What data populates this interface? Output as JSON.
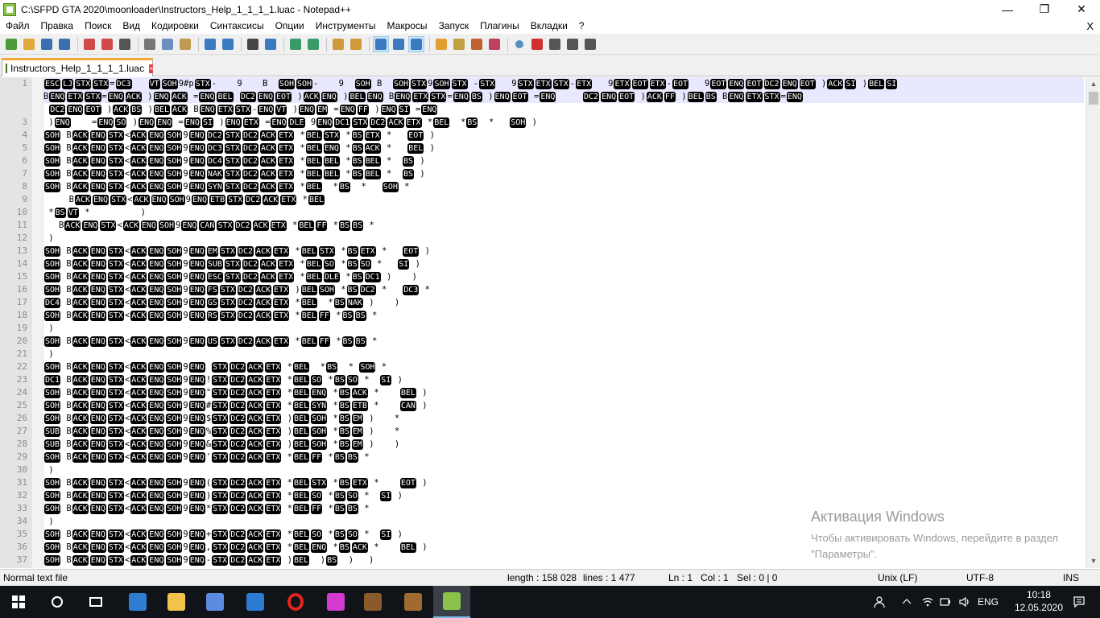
{
  "window": {
    "title": "C:\\SFPD GTA 2020\\moonloader\\Instructors_Help_1_1_1_1.luac - Notepad++",
    "minimize": "—",
    "restore": "❐",
    "close": "✕"
  },
  "menu": {
    "items": [
      "Файл",
      "Правка",
      "Поиск",
      "Вид",
      "Кодировки",
      "Синтаксисы",
      "Опции",
      "Инструменты",
      "Макросы",
      "Запуск",
      "Плагины",
      "Вкладки",
      "?"
    ],
    "close": "X"
  },
  "toolbar": {
    "icons": [
      "new-file-icon",
      "open-file-icon",
      "save-icon",
      "save-all-icon",
      "close-icon",
      "close-all-icon",
      "print-icon",
      "cut-icon",
      "copy-icon",
      "paste-icon",
      "undo-icon",
      "redo-icon",
      "find-icon",
      "replace-icon",
      "zoom-in-icon",
      "zoom-out-icon",
      "sync-v-icon",
      "sync-h-icon",
      "word-wrap-icon",
      "show-all-chars-icon",
      "indent-guide-icon",
      "doc-map-icon",
      "function-list-icon",
      "folder-workspace-icon",
      "monitor-icon",
      "record-macro-icon",
      "stop-record-icon",
      "play-macro-icon",
      "play-multiple-icon",
      "save-macro-icon"
    ],
    "icon_colors": [
      "#4c9a3a",
      "#e0a93a",
      "#3a6fb0",
      "#3a6fb0",
      "#d04a4a",
      "#d04a4a",
      "#555555",
      "#777777",
      "#6a8fc0",
      "#c09a50",
      "#3a7ac0",
      "#3a7ac0",
      "#444444",
      "#3a7ac0",
      "#3a9a6a",
      "#3a9a6a",
      "#d09a3a",
      "#d09a3a",
      "#3a7ac0",
      "#3a7ac0",
      "#3a7ac0",
      "#e0a030",
      "#c0a040",
      "#c06030",
      "#c04060",
      "#5090c0",
      "#d03030",
      "#555555",
      "#555555",
      "#555555"
    ]
  },
  "tab": {
    "label": "Instructors_Help_1_1_1_1.luac",
    "close": "×"
  },
  "editor": {
    "lines": [
      {
        "n": "1",
        "t": "⟦ESC⟧⟦LJ⟧⟦STX⟧⟦STX⟧=⟦DC3⟧   ⟦VT⟧⟦SOH⟧9#p⟦STX⟧-    9    B  ⟦SOH⟧⟦SOH⟧-    9  ⟦SOH⟧ B  ⟦SOH⟧⟦STX⟧9⟦SOH⟧⟦STX⟧ -⟦STX⟧   9⟦STX⟧⟦ETX⟧⟦STX⟧-⟦ETX⟧   9⟦ETX⟧⟦EOT⟧⟦ETX⟧-⟦EOT⟧   9⟦EOT⟧⟦ENQ⟧⟦EOT⟧⟦DC2⟧⟦ENQ⟧⟦EOT⟧ )⟦ACK⟧⟦SI⟧ )⟦BEL⟧⟦SI⟧"
      },
      {
        "n": "",
        "t": "B⟦ENQ⟧⟦ETX⟧⟦STX⟧=⟦ENQ⟧⟦ACK⟧ )⟦ENQ⟧⟦ACK⟧ =⟦ENQ⟧⟦BEL⟧ ⟦DC2⟧⟦ENQ⟧⟦EOT⟧ )⟦ACK⟧⟦ENQ⟧ )⟦BEL⟧⟦ENQ⟧ B⟦ENQ⟧⟦ETX⟧⟦STX⟧=⟦ENQ⟧⟦BS⟧ )⟦ENQ⟧⟦EOT⟧ =⟦ENQ⟧     ⟦DC2⟧⟦ENQ⟧⟦EOT⟧ )⟦ACK⟧⟦FF⟧ )⟦BEL⟧⟦BS⟧ B⟦ENQ⟧⟦ETX⟧⟦STX⟧=⟦ENQ⟧"
      },
      {
        "n": "",
        "t": " ⟦DC2⟧⟦ENQ⟧⟦EOT⟧ )⟦ACK⟧⟦BS⟧ )⟦BEL⟧⟦ACK⟧ B⟦ENQ⟧⟦ETX⟧⟦STX⟧-⟦ENQ⟧⟦VT⟧ )⟦ENQ⟧⟦EM⟧ =⟦ENQ⟧⟦FF⟧ )⟦ENQ⟧⟦SI⟧ =⟦ENQ⟧"
      },
      {
        "n": "3",
        "t": " )⟦ENQ⟧    =⟦ENQ⟧⟦SO⟧ )⟦ENQ⟧⟦ENQ⟧ =⟦ENQ⟧⟦SI⟧ )⟦ENQ⟧⟦ETX⟧ =⟦ENQ⟧⟦DLE⟧ 9⟦ENQ⟧⟦DC1⟧⟦STX⟧⟦DC2⟧⟦ACK⟧⟦ETX⟧ *⟦BEL⟧  *⟦BS⟧  *   ⟦SOH⟧ )"
      },
      {
        "n": "4",
        "t": "⟦SOH⟧ B⟦ACK⟧⟦ENQ⟧⟦STX⟧<⟦ACK⟧⟦ENQ⟧⟦SOH⟧9⟦ENQ⟧⟦DC2⟧⟦STX⟧⟦DC2⟧⟦ACK⟧⟦ETX⟧ *⟦BEL⟧⟦STX⟧ *⟦BS⟧⟦ETX⟧ *   ⟦EOT⟧ )"
      },
      {
        "n": "5",
        "t": "⟦SOH⟧ B⟦ACK⟧⟦ENQ⟧⟦STX⟧<⟦ACK⟧⟦ENQ⟧⟦SOH⟧9⟦ENQ⟧⟦DC3⟧⟦STX⟧⟦DC2⟧⟦ACK⟧⟦ETX⟧ *⟦BEL⟧⟦ENQ⟧ *⟦BS⟧⟦ACK⟧ *   ⟦BEL⟧ )"
      },
      {
        "n": "6",
        "t": "⟦SOH⟧ B⟦ACK⟧⟦ENQ⟧⟦STX⟧<⟦ACK⟧⟦ENQ⟧⟦SOH⟧9⟦ENQ⟧⟦DC4⟧⟦STX⟧⟦DC2⟧⟦ACK⟧⟦ETX⟧ *⟦BEL⟧⟦BEL⟧ *⟦BS⟧⟦BEL⟧ *  ⟦BS⟧ )"
      },
      {
        "n": "7",
        "t": "⟦SOH⟧ B⟦ACK⟧⟦ENQ⟧⟦STX⟧<⟦ACK⟧⟦ENQ⟧⟦SOH⟧9⟦ENQ⟧⟦NAK⟧⟦STX⟧⟦DC2⟧⟦ACK⟧⟦ETX⟧ *⟦BEL⟧⟦BEL⟧ *⟦BS⟧⟦BEL⟧ *  ⟦BS⟧ )"
      },
      {
        "n": "8",
        "t": "⟦SOH⟧ B⟦ACK⟧⟦ENQ⟧⟦STX⟧<⟦ACK⟧⟦ENQ⟧⟦SOH⟧9⟦ENQ⟧⟦SYN⟧⟦STX⟧⟦DC2⟧⟦ACK⟧⟦ETX⟧ *⟦BEL⟧  *⟦BS⟧  *   ⟦SOH⟧ *"
      },
      {
        "n": "9",
        "t": "     B⟦ACK⟧⟦ENQ⟧⟦STX⟧<⟦ACK⟧⟦ENQ⟧⟦SOH⟧9⟦ENQ⟧⟦ETB⟧⟦STX⟧⟦DC2⟧⟦ACK⟧⟦ETX⟧ *⟦BEL⟧"
      },
      {
        "n": "10",
        "t": " *⟦BS⟧⟦VT⟧ *          )"
      },
      {
        "n": "11",
        "t": "   B⟦ACK⟧⟦ENQ⟧⟦STX⟧<⟦ACK⟧⟦ENQ⟧⟦SOH⟧9⟦ENQ⟧⟦CAN⟧⟦STX⟧⟦DC2⟧⟦ACK⟧⟦ETX⟧ *⟦BEL⟧⟦FF⟧ *⟦BS⟧⟦BS⟧ *"
      },
      {
        "n": "12",
        "t": " )"
      },
      {
        "n": "13",
        "t": "⟦SOH⟧ B⟦ACK⟧⟦ENQ⟧⟦STX⟧<⟦ACK⟧⟦ENQ⟧⟦SOH⟧9⟦ENQ⟧⟦EM⟧⟦STX⟧⟦DC2⟧⟦ACK⟧⟦ETX⟧ *⟦BEL⟧⟦STX⟧ *⟦BS⟧⟦ETX⟧ *   ⟦EOT⟧ )"
      },
      {
        "n": "14",
        "t": "⟦SOH⟧ B⟦ACK⟧⟦ENQ⟧⟦STX⟧<⟦ACK⟧⟦ENQ⟧⟦SOH⟧9⟦ENQ⟧⟦SUB⟧⟦STX⟧⟦DC2⟧⟦ACK⟧⟦ETX⟧ *⟦BEL⟧⟦SO⟧ *⟦BS⟧⟦SO⟧ *   ⟦SI⟧ )"
      },
      {
        "n": "15",
        "t": "⟦SOH⟧ B⟦ACK⟧⟦ENQ⟧⟦STX⟧<⟦ACK⟧⟦ENQ⟧⟦SOH⟧9⟦ENQ⟧⟦ESC⟧⟦STX⟧⟦DC2⟧⟦ACK⟧⟦ETX⟧ *⟦BEL⟧⟦DLE⟧ *⟦BS⟧⟦DC1⟧ )    )"
      },
      {
        "n": "16",
        "t": "⟦SOH⟧ B⟦ACK⟧⟦ENQ⟧⟦STX⟧<⟦ACK⟧⟦ENQ⟧⟦SOH⟧9⟦ENQ⟧⟦FS⟧⟦STX⟧⟦DC2⟧⟦ACK⟧⟦ETX⟧ )⟦BEL⟧⟦SOH⟧ *⟦BS⟧⟦DC2⟧ *   ⟦DC3⟧ *"
      },
      {
        "n": "17",
        "t": "⟦DC4⟧ B⟦ACK⟧⟦ENQ⟧⟦STX⟧<⟦ACK⟧⟦ENQ⟧⟦SOH⟧9⟦ENQ⟧⟦GS⟧⟦STX⟧⟦DC2⟧⟦ACK⟧⟦ETX⟧ *⟦BEL⟧  *⟦BS⟧⟦NAK⟧ )    )"
      },
      {
        "n": "18",
        "t": "⟦SOH⟧ B⟦ACK⟧⟦ENQ⟧⟦STX⟧<⟦ACK⟧⟦ENQ⟧⟦SOH⟧9⟦ENQ⟧⟦RS⟧⟦STX⟧⟦DC2⟧⟦ACK⟧⟦ETX⟧ *⟦BEL⟧⟦FF⟧ *⟦BS⟧⟦BS⟧ *"
      },
      {
        "n": "19",
        "t": " )"
      },
      {
        "n": "20",
        "t": "⟦SOH⟧ B⟦ACK⟧⟦ENQ⟧⟦STX⟧<⟦ACK⟧⟦ENQ⟧⟦SOH⟧9⟦ENQ⟧⟦US⟧⟦STX⟧⟦DC2⟧⟦ACK⟧⟦ETX⟧ *⟦BEL⟧⟦FF⟧ *⟦BS⟧⟦BS⟧ *"
      },
      {
        "n": "21",
        "t": " )"
      },
      {
        "n": "22",
        "t": "⟦SOH⟧ B⟦ACK⟧⟦ENQ⟧⟦STX⟧<⟦ACK⟧⟦ENQ⟧⟦SOH⟧9⟦ENQ⟧ ⟦STX⟧⟦DC2⟧⟦ACK⟧⟦ETX⟧ *⟦BEL⟧  *⟦BS⟧  * ⟦SOH⟧ *"
      },
      {
        "n": "23",
        "t": "⟦DC1⟧ B⟦ACK⟧⟦ENQ⟧⟦STX⟧<⟦ACK⟧⟦ENQ⟧⟦SOH⟧9⟦ENQ⟧!⟦STX⟧⟦DC2⟧⟦ACK⟧⟦ETX⟧ *⟦BEL⟧⟦SO⟧ *⟦BS⟧⟦SO⟧ *  ⟦SI⟧ )"
      },
      {
        "n": "24",
        "t": "⟦SOH⟧ B⟦ACK⟧⟦ENQ⟧⟦STX⟧<⟦ACK⟧⟦ENQ⟧⟦SOH⟧9⟦ENQ⟧\"⟦STX⟧⟦DC2⟧⟦ACK⟧⟦ETX⟧ *⟦BEL⟧⟦ENQ⟧ *⟦BS⟧⟦ACK⟧ *    ⟦BEL⟧ )"
      },
      {
        "n": "25",
        "t": "⟦SOH⟧ B⟦ACK⟧⟦ENQ⟧⟦STX⟧<⟦ACK⟧⟦ENQ⟧⟦SOH⟧9⟦ENQ⟧#⟦STX⟧⟦DC2⟧⟦ACK⟧⟦ETX⟧ *⟦BEL⟧⟦SYN⟧ *⟦BS⟧⟦ETB⟧ *    ⟦CAN⟧ )"
      },
      {
        "n": "26",
        "t": "⟦SOH⟧ B⟦ACK⟧⟦ENQ⟧⟦STX⟧<⟦ACK⟧⟦ENQ⟧⟦SOH⟧9⟦ENQ⟧$⟦STX⟧⟦DC2⟧⟦ACK⟧⟦ETX⟧ )⟦BEL⟧⟦SOH⟧ *⟦BS⟧⟦EM⟧ )    *"
      },
      {
        "n": "27",
        "t": "⟦SUB⟧ B⟦ACK⟧⟦ENQ⟧⟦STX⟧<⟦ACK⟧⟦ENQ⟧⟦SOH⟧9⟦ENQ⟧%⟦STX⟧⟦DC2⟧⟦ACK⟧⟦ETX⟧ )⟦BEL⟧⟦SOH⟧ *⟦BS⟧⟦EM⟧ )    *"
      },
      {
        "n": "28",
        "t": "⟦SUB⟧ B⟦ACK⟧⟦ENQ⟧⟦STX⟧<⟦ACK⟧⟦ENQ⟧⟦SOH⟧9⟦ENQ⟧&⟦STX⟧⟦DC2⟧⟦ACK⟧⟦ETX⟧ )⟦BEL⟧⟦SOH⟧ *⟦BS⟧⟦EM⟧ )    )"
      },
      {
        "n": "29",
        "t": "⟦SOH⟧ B⟦ACK⟧⟦ENQ⟧⟦STX⟧<⟦ACK⟧⟦ENQ⟧⟦SOH⟧9⟦ENQ⟧'⟦STX⟧⟦DC2⟧⟦ACK⟧⟦ETX⟧ *⟦BEL⟧⟦FF⟧ *⟦BS⟧⟦BS⟧ *"
      },
      {
        "n": "30",
        "t": " )"
      },
      {
        "n": "31",
        "t": "⟦SOH⟧ B⟦ACK⟧⟦ENQ⟧⟦STX⟧<⟦ACK⟧⟦ENQ⟧⟦SOH⟧9⟦ENQ⟧(⟦STX⟧⟦DC2⟧⟦ACK⟧⟦ETX⟧ *⟦BEL⟧⟦STX⟧ *⟦BS⟧⟦ETX⟧ *    ⟦EOT⟧ )"
      },
      {
        "n": "32",
        "t": "⟦SOH⟧ B⟦ACK⟧⟦ENQ⟧⟦STX⟧<⟦ACK⟧⟦ENQ⟧⟦SOH⟧9⟦ENQ⟧)⟦STX⟧⟦DC2⟧⟦ACK⟧⟦ETX⟧ *⟦BEL⟧⟦SO⟧ *⟦BS⟧⟦SO⟧ *  ⟦SI⟧ )"
      },
      {
        "n": "33",
        "t": "⟦SOH⟧ B⟦ACK⟧⟦ENQ⟧⟦STX⟧<⟦ACK⟧⟦ENQ⟧⟦SOH⟧9⟦ENQ⟧*⟦STX⟧⟦DC2⟧⟦ACK⟧⟦ETX⟧ *⟦BEL⟧⟦FF⟧ *⟦BS⟧⟦BS⟧ *"
      },
      {
        "n": "34",
        "t": " )"
      },
      {
        "n": "35",
        "t": "⟦SOH⟧ B⟦ACK⟧⟦ENQ⟧⟦STX⟧<⟦ACK⟧⟦ENQ⟧⟦SOH⟧9⟦ENQ⟧+⟦STX⟧⟦DC2⟧⟦ACK⟧⟦ETX⟧ *⟦BEL⟧⟦SO⟧ *⟦BS⟧⟦SO⟧ *  ⟦SI⟧ )"
      },
      {
        "n": "36",
        "t": "⟦SOH⟧ B⟦ACK⟧⟦ENQ⟧⟦STX⟧<⟦ACK⟧⟦ENQ⟧⟦SOH⟧9⟦ENQ⟧,⟦STX⟧⟦DC2⟧⟦ACK⟧⟦ETX⟧ *⟦BEL⟧⟦ENQ⟧ *⟦BS⟧⟦ACK⟧ *    ⟦BEL⟧ )"
      },
      {
        "n": "37",
        "t": "⟦SOH⟧ B⟦ACK⟧⟦ENQ⟧⟦STX⟧<⟦ACK⟧⟦ENQ⟧⟦SOH⟧9⟦ENQ⟧-⟦STX⟧⟦DC2⟧⟦ACK⟧⟦ETX⟧ )⟦BEL⟧  )⟦BS⟧  )   )"
      }
    ]
  },
  "watermark": {
    "title": "Активация Windows",
    "text": "Чтобы активировать Windows, перейдите в раздел \"Параметры\"."
  },
  "status": {
    "type": "Normal text file",
    "length": "length : 158 028",
    "lines": "lines : 1 477",
    "ln": "Ln : 1",
    "col": "Col : 1",
    "sel": "Sel : 0 | 0",
    "eol": "Unix (LF)",
    "encoding": "UTF-8",
    "mode": "INS"
  },
  "taskbar": {
    "apps": [
      "start-icon",
      "search-icon",
      "task-view-icon",
      "edge-icon",
      "explorer-icon",
      "store-icon",
      "mail-icon",
      "opera-icon",
      "app-pink-icon",
      "game-avatar-1-icon",
      "game-avatar-2-icon",
      "notepadpp-icon"
    ],
    "app_colors": [
      "#ffffff",
      "#ffffff",
      "#ffffff",
      "#2f7dd2",
      "#f3c24a",
      "#5b8ce0",
      "#2a7bd1",
      "#e52421",
      "#d33bd0",
      "#8a5a2a",
      "#a06a30",
      "#8bc34a"
    ],
    "lang": "ENG",
    "time": "10:18",
    "date": "12.05.2020"
  }
}
